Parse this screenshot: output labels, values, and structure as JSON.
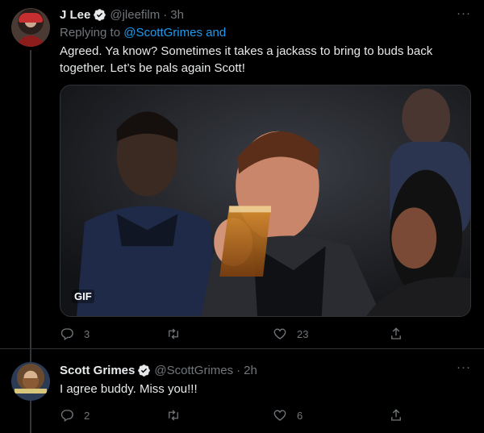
{
  "tweets": [
    {
      "author": {
        "name": "J Lee",
        "handle": "@jleefilm",
        "time": "3h"
      },
      "replying_prefix": "Replying to",
      "replying_to": "@ScottGrimes and",
      "text": "Agreed. Ya know? Sometimes it takes a jackass to bring to buds back together. Let’s be pals again Scott!",
      "media": {
        "type": "gif",
        "badge": "GIF"
      },
      "stats": {
        "replies": "3",
        "retweets": "",
        "likes": "23"
      }
    },
    {
      "author": {
        "name": "Scott Grimes",
        "handle": "@ScottGrimes",
        "time": "2h"
      },
      "text": "I agree buddy. Miss you!!!",
      "stats": {
        "replies": "2",
        "retweets": "",
        "likes": "6"
      }
    }
  ],
  "ui": {
    "separator_dot": "·",
    "more_glyph": "···"
  },
  "colors": {
    "background": "#000000",
    "primary_text": "#e7e9ea",
    "secondary_text": "#71767b",
    "accent": "#1d9bf0",
    "verified": "#e7e9ea",
    "border": "#2f3336"
  },
  "icons": [
    "verified-icon",
    "more-icon",
    "reply-icon",
    "retweet-icon",
    "like-icon",
    "share-icon"
  ]
}
